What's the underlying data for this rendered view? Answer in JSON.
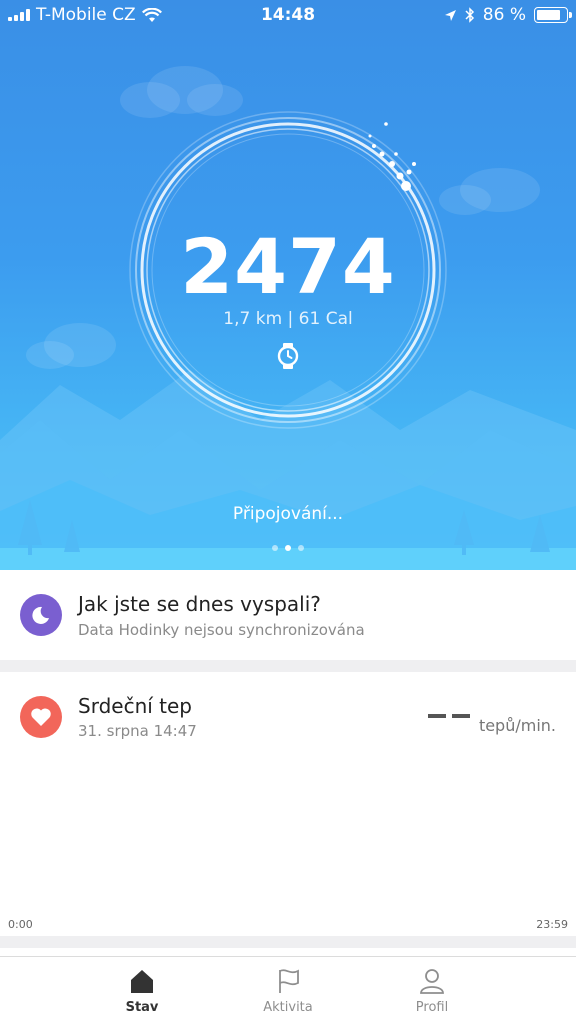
{
  "status_bar": {
    "carrier": "T-Mobile CZ",
    "time": "14:48",
    "battery": "86 %",
    "battery_level": 0.86
  },
  "hero": {
    "steps": "2474",
    "stats": "1,7 km | 61 Cal",
    "connection_status": "Připojování...",
    "page_indicator": {
      "count": 3,
      "active": 1
    }
  },
  "sleep_card": {
    "title": "Jak jste se dnes vyspali?",
    "subtitle": "Data Hodinky nejsou synchronizována",
    "icon": "moon-sleep-icon",
    "icon_color": "#7a5fd0"
  },
  "heart_card": {
    "title": "Srdeční tep",
    "timestamp": "31. srpna 14:47",
    "unit": "tepů/min.",
    "icon": "heart-icon",
    "icon_color": "#f2665a",
    "axis_start": "0:00",
    "axis_end": "23:59"
  },
  "tabs": [
    {
      "label": "Stav",
      "icon": "home-icon",
      "active": true
    },
    {
      "label": "Aktivita",
      "icon": "flag-icon",
      "active": false
    },
    {
      "label": "Profil",
      "icon": "person-icon",
      "active": false
    }
  ],
  "colors": {
    "hero_top": "#3a8fe6",
    "hero_bottom": "#52c6f7"
  }
}
